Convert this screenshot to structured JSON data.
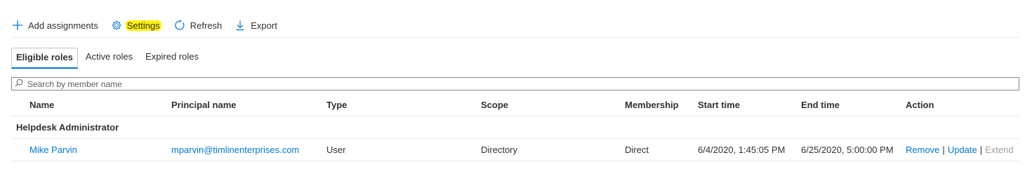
{
  "toolbar": {
    "add_label": "Add assignments",
    "add_icon": "plus-icon",
    "settings_label": "Settings",
    "settings_icon": "gear-icon",
    "refresh_label": "Refresh",
    "refresh_icon": "refresh-icon",
    "export_label": "Export",
    "export_icon": "download-icon",
    "highlight_color": "#fff200"
  },
  "tabs": [
    {
      "label": "Eligible roles",
      "active": true
    },
    {
      "label": "Active roles",
      "active": false
    },
    {
      "label": "Expired roles",
      "active": false
    }
  ],
  "search": {
    "placeholder": "Search by member name",
    "value": "",
    "icon": "search-icon"
  },
  "table": {
    "columns": {
      "name": "Name",
      "principal": "Principal name",
      "type": "Type",
      "scope": "Scope",
      "membership": "Membership",
      "start": "Start time",
      "end": "End time",
      "action": "Action"
    },
    "group": "Helpdesk Administrator",
    "rows": [
      {
        "name": "Mike Parvin",
        "principal": "mparvin@timlinenterprises.com",
        "type": "User",
        "scope": "Directory",
        "membership": "Direct",
        "start": "6/4/2020, 1:45:05 PM",
        "end": "6/25/2020, 5:00:00 PM",
        "actions": {
          "remove": "Remove",
          "update": "Update",
          "extend": "Extend",
          "separator": "|"
        }
      }
    ]
  },
  "colors": {
    "accent": "#0078d4",
    "text": "#323130",
    "disabled": "#a19f9d",
    "divider": "#edebe9"
  }
}
